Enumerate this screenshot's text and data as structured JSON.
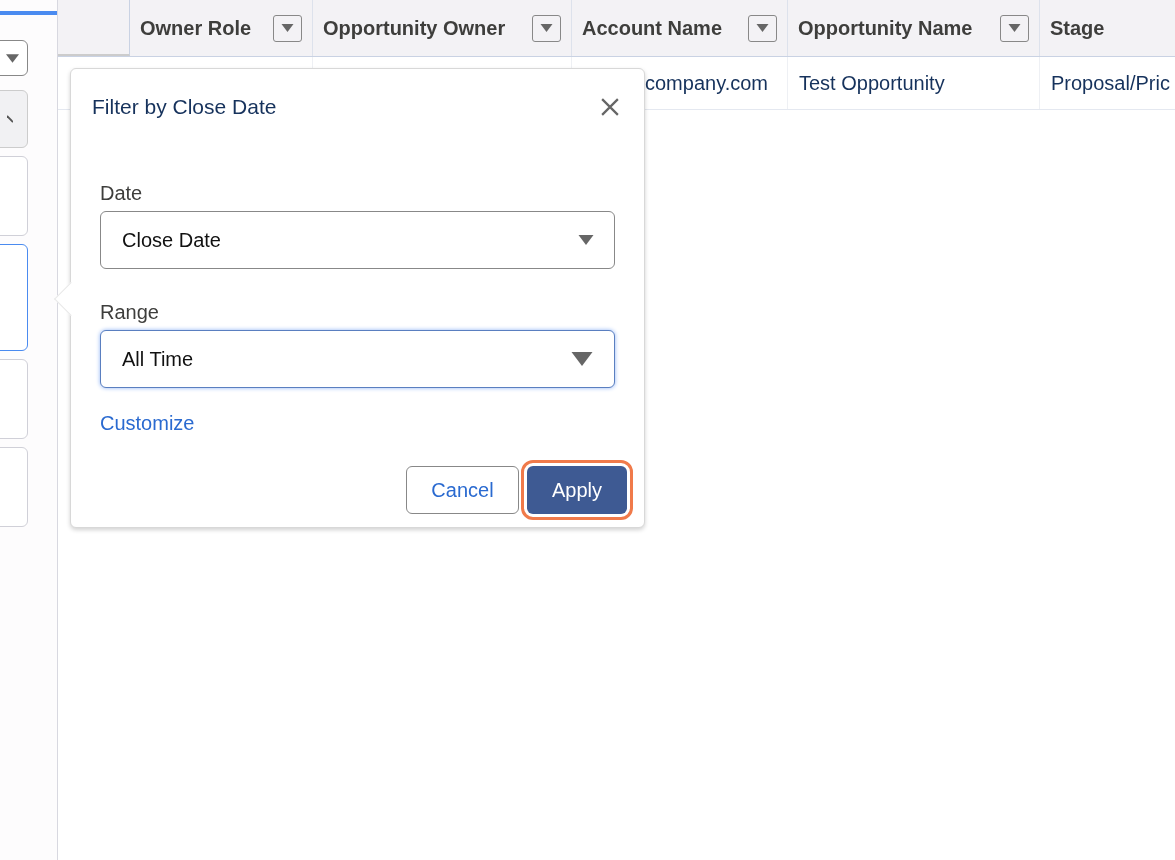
{
  "sidebar": {
    "cards": [
      {
        "selected": false
      },
      {
        "selected": true
      },
      {
        "selected": false
      },
      {
        "selected": false
      }
    ]
  },
  "table": {
    "columns": [
      {
        "label": "Owner Role",
        "has_menu": true
      },
      {
        "label": "Opportunity Owner",
        "has_menu": true
      },
      {
        "label": "Account Name",
        "has_menu": true
      },
      {
        "label": "Opportunity Name",
        "has_menu": true
      },
      {
        "label": "Stage",
        "has_menu": false
      }
    ],
    "rows": [
      [
        "",
        "",
        "company.com",
        "Test Opportunity",
        "Proposal/Pric"
      ]
    ]
  },
  "popover": {
    "title": "Filter by Close Date",
    "fields": [
      {
        "label": "Date",
        "value": "Close Date",
        "focused": false
      },
      {
        "label": "Range",
        "value": "All Time",
        "focused": true
      }
    ],
    "link": "Customize",
    "buttons": [
      {
        "label": "Cancel",
        "kind": "secondary",
        "focused": false
      },
      {
        "label": "Apply",
        "kind": "primary",
        "focused": true
      }
    ]
  }
}
